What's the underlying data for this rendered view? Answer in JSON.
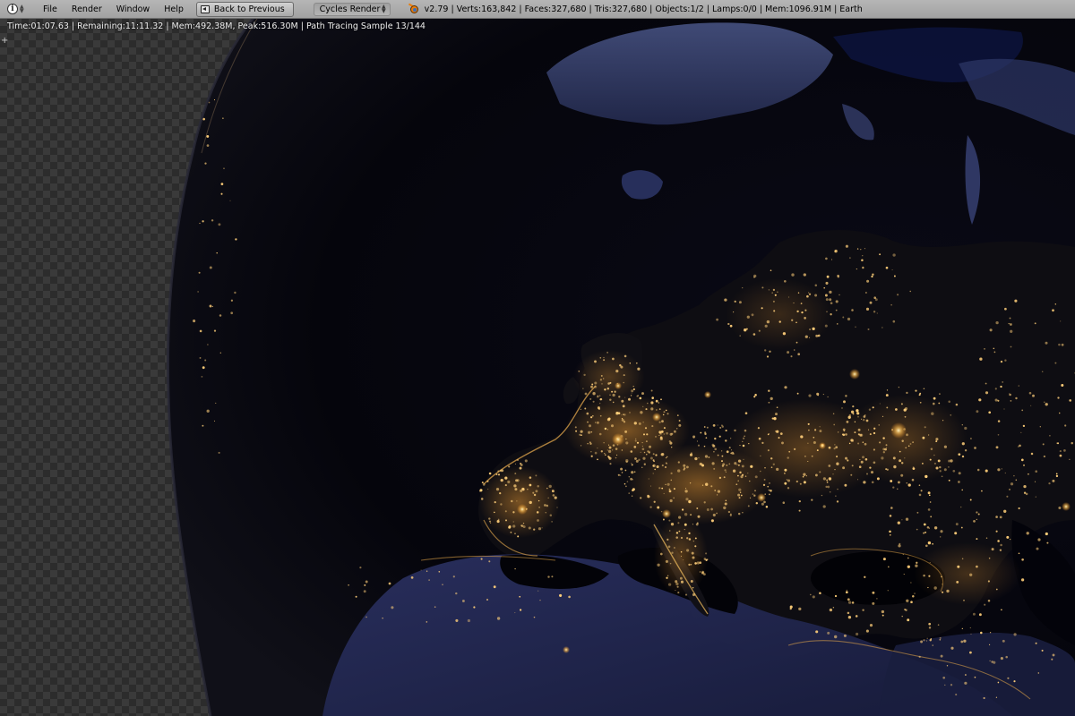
{
  "header": {
    "editor_icon": "info-icon",
    "menus": [
      "File",
      "Render",
      "Window",
      "Help"
    ],
    "back_button": "Back to Previous",
    "render_engine": "Cycles Render",
    "stats": "v2.79 | Verts:163,842 | Faces:327,680 | Tris:327,680 | Objects:1/2 | Lamps:0/0 | Mem:1096.91M | Earth"
  },
  "render": {
    "status": "Time:01:07.63 | Remaining:11:11.32 | Mem:492.38M, Peak:516.30M | Path Tracing Sample 13/144"
  },
  "colors": {
    "header_bg": "#a9a9a9",
    "city_lights": "#ffcf7a",
    "ocean": "#04040c"
  }
}
